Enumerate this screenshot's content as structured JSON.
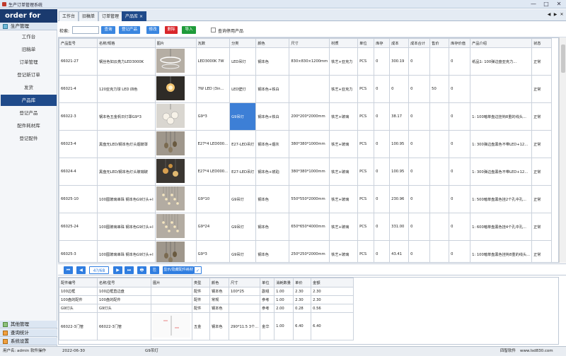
{
  "window": {
    "title": "生产订单管理系统",
    "controls": [
      "—",
      "□",
      "✕"
    ]
  },
  "brand": "order for goods",
  "sidebar": {
    "section_top": "生产管理",
    "items": [
      "工作台",
      "旧稿单",
      "订单管理",
      "登记新订单",
      "发货",
      "产品库",
      "登记产品",
      "配件耗材库",
      "登记配件"
    ],
    "active_index": 5,
    "bottom_sections": [
      "其他管理",
      "查询统计",
      "系统设置"
    ]
  },
  "tabs": {
    "items": [
      "工作台",
      "旧稿单",
      "订单管理",
      "产品库"
    ],
    "active_index": 3,
    "close": "×"
  },
  "toolbar": {
    "search_label": "检索:",
    "search_value": "",
    "buttons": {
      "query": "查询",
      "register": "登记产品",
      "edit": "修改",
      "delete": "删除",
      "import": "导入"
    },
    "checkbox_label": "查询停用产品"
  },
  "products": {
    "headers": [
      "产品型号",
      "名称/规格",
      "图片",
      "瓦数",
      "分类",
      "颜色",
      "尺寸",
      "材质",
      "单位",
      "库存",
      "成本",
      "成本合计",
      "售价",
      "库存价值",
      "产品介绍",
      "状态"
    ],
    "rows": [
      [
        "66021-27",
        "钢丝色如云亮力LED3000K",
        "",
        "LED3000K 7W",
        "LED吊灯",
        "钢本色",
        "830×830×1200mm",
        "铁艺+亚克力",
        "PCS",
        "0",
        "300.19",
        "0",
        "",
        "0",
        "纸品1: 100弹边盘亚克力...",
        "正常"
      ],
      [
        "66021-4",
        "120亚克力球 LED 四色",
        "",
        "7W LED (3in...",
        "LED壁灯",
        "钢本色+铁白",
        "",
        "铁艺+亚克力",
        "PCS",
        "0",
        "0",
        "0",
        "50",
        "0",
        "",
        "正常"
      ],
      [
        "66022-3",
        "钢本色五金帆日灯罩G9*3",
        "",
        "G9*3",
        "G9吊灯",
        "钢本色+铁白",
        "200*200*2000mm",
        "铁艺+玻璃",
        "PCS",
        "0",
        "38.17",
        "0",
        "",
        "0",
        "1: 100暗萃盘边挂钩8重的线头...",
        "正常"
      ],
      [
        "66023-4",
        "黑盘无LED/钢本色灯头烟玻罩",
        "",
        "E27*4 LED000...",
        "E27-LED吊灯",
        "钢本色+烟灰",
        "380*380*1000mm",
        "铁艺+玻璃",
        "PCS",
        "0",
        "100.95",
        "0",
        "",
        "0",
        "1: 300弹边盘黑色不带LED+12...",
        "正常"
      ],
      [
        "66024-4",
        "黑盘无LED/钢本色灯头玻瑞玻",
        "",
        "E27*4 LED000...",
        "E27-LED吊灯",
        "钢本色+琥珀",
        "380*380*1000mm",
        "铁艺+玻璃",
        "PCS",
        "0",
        "100.95",
        "0",
        "",
        "0",
        "1: 300弹边盘黑色不带LED+12...",
        "正常"
      ],
      [
        "66025-10",
        "100圆玻璃串珠 钢本色G9灯头+I",
        "",
        "G9*10",
        "G9吊灯",
        "钢本色",
        "550*550*2000mm",
        "铁艺+玻璃",
        "PCS",
        "0",
        "230.96",
        "0",
        "",
        "0",
        "1: 500暗萃盘黑色挂2个孔中孔...",
        "正常"
      ],
      [
        "66025-24",
        "100圆玻璃串珠 钢本色G9灯头+I",
        "",
        "G9*24",
        "G9吊灯",
        "钢本色",
        "650*650*4000mm",
        "铁艺+玻璃",
        "PCS",
        "0",
        "331.00",
        "0",
        "",
        "0",
        "1: 600暗萃盘黑色挂4个孔中孔...",
        "正常"
      ],
      [
        "66025-3",
        "100圆玻璃串珠 钢本色G9灯头+I",
        "",
        "G9*3",
        "G9吊灯",
        "钢本色",
        "250*250*2000mm",
        "铁艺+玻璃",
        "PCS",
        "0",
        "43.41",
        "0",
        "",
        "0",
        "1: 100暗萃盘黑色挂钩8重的线头...",
        "正常"
      ]
    ],
    "selected_row": 2,
    "selected_col": 4,
    "thumb_styles": [
      "ring",
      "dark",
      "globe",
      "cluster",
      "mixed",
      "drops",
      "drops",
      "cluster"
    ]
  },
  "pager": {
    "first": "⏮",
    "prev": "◀",
    "page": "4?/68",
    "next": "▶",
    "last": "⏭",
    "print": "🖶",
    "export": "⎘",
    "toggle_label": "显示/隐藏配件耗材"
  },
  "parts": {
    "headers": [
      "配件编号",
      "名称/型号",
      "图片",
      "类型",
      "颜色",
      "尺寸",
      "单位",
      "消耗数量",
      "单价",
      "金额"
    ],
    "rows": [
      [
        "100边框",
        "100边框直边盘",
        "",
        "配件",
        "钢本色",
        "100*25",
        "副组",
        "1.00",
        "2.30",
        "2.30"
      ],
      [
        "100盘的配件",
        "100盘的配件",
        "",
        "配件",
        "常规",
        "",
        "参考",
        "1.00",
        "2.30",
        "2.30"
      ],
      [
        "G9灯头",
        "G9灯头",
        "",
        "配件",
        "钢本色",
        "",
        "参考",
        "2.00",
        "0.28",
        "0.56"
      ],
      [
        "66022-3门管",
        "66022-3门管",
        "",
        "五金",
        "钢本色",
        "290*11.5 3个...",
        "金华",
        "1.00",
        "6.40",
        "6.40"
      ]
    ]
  },
  "status": {
    "user_label": "用户名:",
    "user_value": "admin 软件操作",
    "date": "2022-06-30",
    "selected_cell": "G9吊灯",
    "company": "四智软件",
    "website": "www.lsd830.com"
  }
}
